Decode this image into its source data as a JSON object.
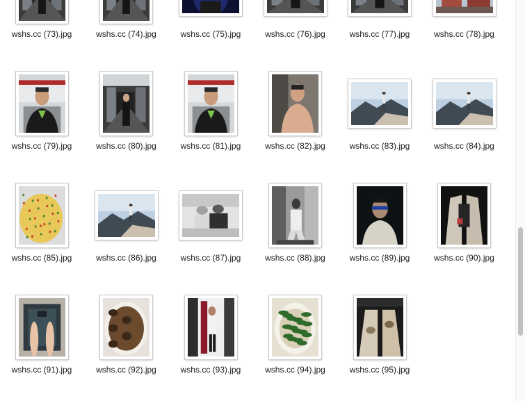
{
  "window": {
    "title": ""
  },
  "files": [
    {
      "name": "wshs.cc (73).jpg",
      "kind": "subway",
      "orient": "portrait"
    },
    {
      "name": "wshs.cc (74).jpg",
      "kind": "subway",
      "orient": "portrait"
    },
    {
      "name": "wshs.cc (75).jpg",
      "kind": "dark-portrait",
      "orient": "landscape"
    },
    {
      "name": "wshs.cc (76).jpg",
      "kind": "subway",
      "orient": "landscape"
    },
    {
      "name": "wshs.cc (77).jpg",
      "kind": "subway",
      "orient": "landscape"
    },
    {
      "name": "wshs.cc (78).jpg",
      "kind": "building",
      "orient": "landscape"
    },
    {
      "name": "wshs.cc (79).jpg",
      "kind": "selfie",
      "orient": "portrait"
    },
    {
      "name": "wshs.cc (80).jpg",
      "kind": "subway",
      "orient": "portrait"
    },
    {
      "name": "wshs.cc (81).jpg",
      "kind": "selfie",
      "orient": "portrait"
    },
    {
      "name": "wshs.cc (82).jpg",
      "kind": "shirtless",
      "orient": "portrait"
    },
    {
      "name": "wshs.cc (83).jpg",
      "kind": "mountain",
      "orient": "landscape"
    },
    {
      "name": "wshs.cc (84).jpg",
      "kind": "mountain",
      "orient": "landscape"
    },
    {
      "name": "wshs.cc (85).jpg",
      "kind": "omelette",
      "orient": "portrait"
    },
    {
      "name": "wshs.cc (86).jpg",
      "kind": "mountain",
      "orient": "landscape"
    },
    {
      "name": "wshs.cc (87).jpg",
      "kind": "couple",
      "orient": "landscape"
    },
    {
      "name": "wshs.cc (88).jpg",
      "kind": "bw-sitting",
      "orient": "portrait"
    },
    {
      "name": "wshs.cc (89).jpg",
      "kind": "night-glasses",
      "orient": "portrait"
    },
    {
      "name": "wshs.cc (90).jpg",
      "kind": "night-legs",
      "orient": "portrait"
    },
    {
      "name": "wshs.cc (91).jpg",
      "kind": "scale",
      "orient": "portrait"
    },
    {
      "name": "wshs.cc (92).jpg",
      "kind": "food-bowl",
      "orient": "portrait"
    },
    {
      "name": "wshs.cc (93).jpg",
      "kind": "hallway",
      "orient": "portrait"
    },
    {
      "name": "wshs.cc (94).jpg",
      "kind": "greens",
      "orient": "portrait"
    },
    {
      "name": "wshs.cc (95).jpg",
      "kind": "car-legs",
      "orient": "portrait"
    }
  ],
  "scrollbar": {
    "position": 0.78,
    "visible_fraction": 0.27
  },
  "colors": {
    "label": "#1a1a1a",
    "frame_shadow": "#c9c9c9",
    "scrollbar_thumb": "#c1c1c1"
  }
}
